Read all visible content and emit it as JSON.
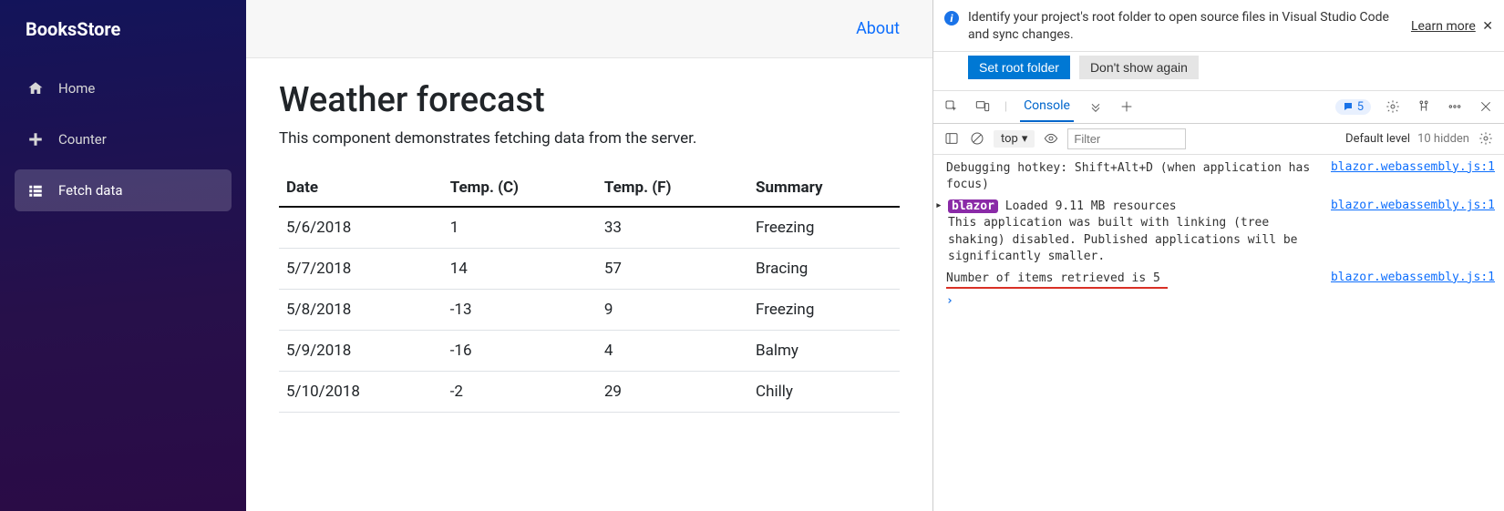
{
  "brand": "BooksStore",
  "nav": {
    "home": "Home",
    "counter": "Counter",
    "fetch": "Fetch data"
  },
  "topbar": {
    "about": "About"
  },
  "page": {
    "title": "Weather forecast",
    "subtitle": "This component demonstrates fetching data from the server."
  },
  "table": {
    "headers": {
      "date": "Date",
      "tempC": "Temp. (C)",
      "tempF": "Temp. (F)",
      "summary": "Summary"
    },
    "rows": [
      {
        "date": "5/6/2018",
        "tc": "1",
        "tf": "33",
        "sum": "Freezing"
      },
      {
        "date": "5/7/2018",
        "tc": "14",
        "tf": "57",
        "sum": "Bracing"
      },
      {
        "date": "5/8/2018",
        "tc": "-13",
        "tf": "9",
        "sum": "Freezing"
      },
      {
        "date": "5/9/2018",
        "tc": "-16",
        "tf": "4",
        "sum": "Balmy"
      },
      {
        "date": "5/10/2018",
        "tc": "-2",
        "tf": "29",
        "sum": "Chilly"
      }
    ]
  },
  "devtools": {
    "infobar": {
      "icon": "i",
      "text": "Identify your project's root folder to open source files in Visual Studio Code and sync changes.",
      "learn_more": "Learn more",
      "set_root": "Set root folder",
      "dont_show": "Don't show again"
    },
    "tabs": {
      "console": "Console"
    },
    "badge_count": "5",
    "filter": {
      "context": "top",
      "placeholder": "Filter",
      "level": "Default level",
      "hidden": "10 hidden"
    },
    "logs": {
      "hotkey": "Debugging hotkey: Shift+Alt+D (when application has focus)",
      "src": "blazor.webassembly.js:1",
      "blazor_tag": "blazor",
      "loaded": "Loaded 9.11 MB resources",
      "built": "This application was built with linking (tree shaking) disabled. Published applications will be significantly smaller.",
      "items": "Number of items retrieved is 5"
    }
  }
}
